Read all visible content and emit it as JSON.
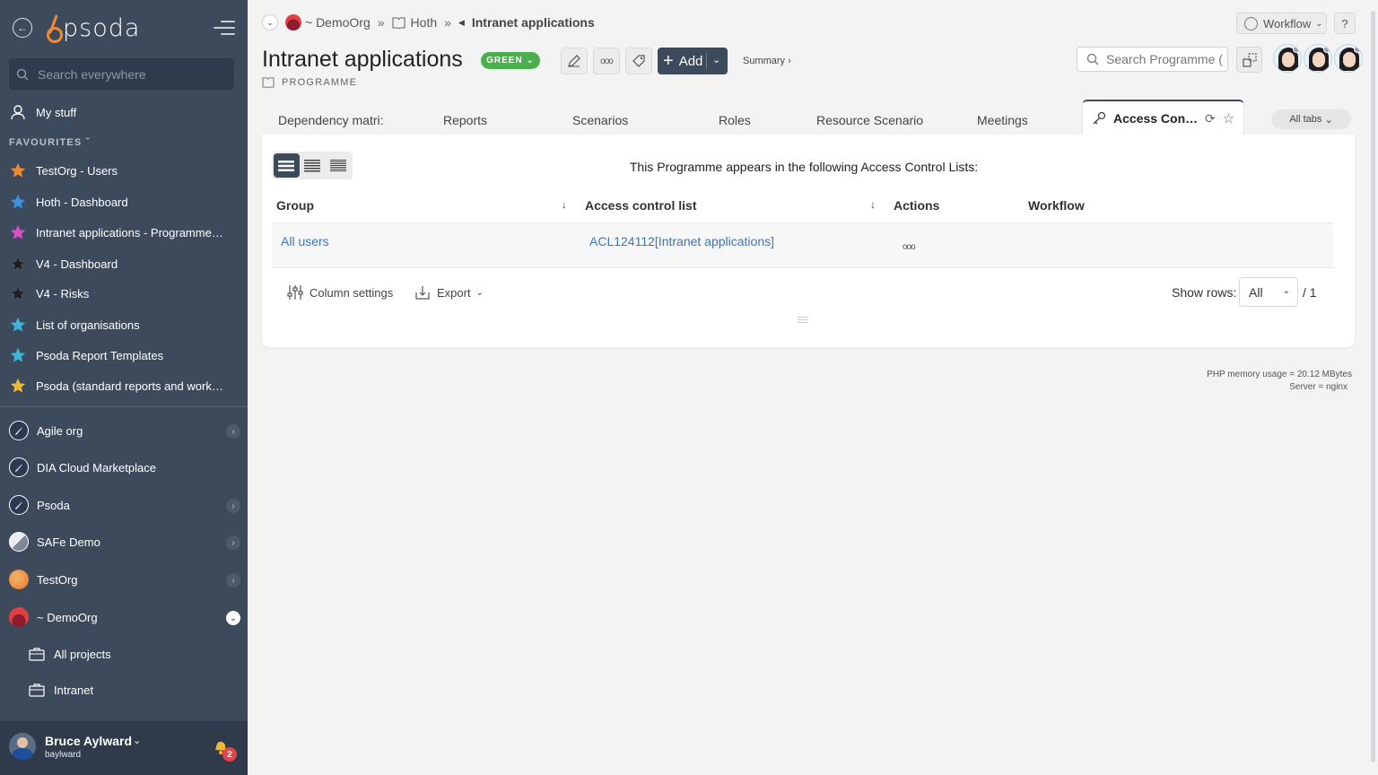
{
  "sidebar": {
    "logo_text": "psoda",
    "search_placeholder": "Search everywhere",
    "my_stuff": "My stuff",
    "favourites_title": "FAVOURITES",
    "favourites": [
      {
        "label": "TestOrg - Users",
        "star_color": "#f08a32"
      },
      {
        "label": "Hoth - Dashboard",
        "star_color": "#3b8fe3"
      },
      {
        "label": "Intranet applications - Programme…",
        "star_color": "#d94fc6"
      },
      {
        "label": "V4 - Dashboard",
        "star_color": "#1e1e22"
      },
      {
        "label": "V4 - Risks",
        "star_color": "#1e1e22"
      },
      {
        "label": "List of organisations",
        "star_color": "#3fb3d8"
      },
      {
        "label": "Psoda Report Templates",
        "star_color": "#3fb3d8"
      },
      {
        "label": "Psoda (standard reports and work…",
        "star_color": "#e8b83a"
      }
    ],
    "orgs": [
      {
        "label": "Agile org",
        "icon": "rocket-icon",
        "expandable": true
      },
      {
        "label": "DIA Cloud Marketplace",
        "icon": "rocket-icon",
        "expandable": false
      },
      {
        "label": "Psoda",
        "icon": "rocket-icon",
        "expandable": true
      },
      {
        "label": "SAFe Demo",
        "icon": "safe-icon",
        "expandable": true
      },
      {
        "label": "TestOrg",
        "icon": "orange-circle-icon",
        "expandable": true
      },
      {
        "label": "~ DemoOrg",
        "icon": "sunset-icon",
        "expandable": true,
        "expanded": true
      }
    ],
    "sub_items": [
      {
        "label": "All projects",
        "icon": "briefcase-icon"
      },
      {
        "label": "Intranet",
        "icon": "briefcase-icon"
      }
    ],
    "user": {
      "name": "Bruce Aylward",
      "login": "baylward",
      "notifications": "2"
    }
  },
  "breadcrumb": {
    "org": "~ DemoOrg",
    "portfolio": "Hoth",
    "current": "Intranet applications"
  },
  "topright": {
    "workflow_label": "Workflow",
    "help_label": "?"
  },
  "header": {
    "title": "Intranet applications",
    "status_badge": "GREEN",
    "type_label": "PROGRAMME",
    "add_label": "Add",
    "summary_link": "Summary ›",
    "search_placeholder": "Search Programme (",
    "more_label": "ooo"
  },
  "tabs": [
    {
      "label": "Dependency matri:"
    },
    {
      "label": "Reports"
    },
    {
      "label": "Scenarios"
    },
    {
      "label": "Roles"
    },
    {
      "label": "Resource Scenario:"
    },
    {
      "label": "Meetings"
    }
  ],
  "active_tab": {
    "label": "Access Contr…"
  },
  "all_tabs_label": "All tabs",
  "panel": {
    "message": "This Programme appears in the following Access Control Lists:",
    "columns": [
      "Group",
      "Access control list",
      "Actions",
      "Workflow"
    ],
    "rows": [
      {
        "group": "All users",
        "acl": "ACL124112[Intranet applications]",
        "actions": "ooo"
      }
    ],
    "column_settings_label": "Column settings",
    "export_label": "Export",
    "show_rows_label": "Show rows:",
    "rows_value": "All",
    "rows_total": "/ 1"
  },
  "footer": {
    "memory": "PHP memory usage = 20.12 MBytes",
    "server": "Server = nginx"
  }
}
